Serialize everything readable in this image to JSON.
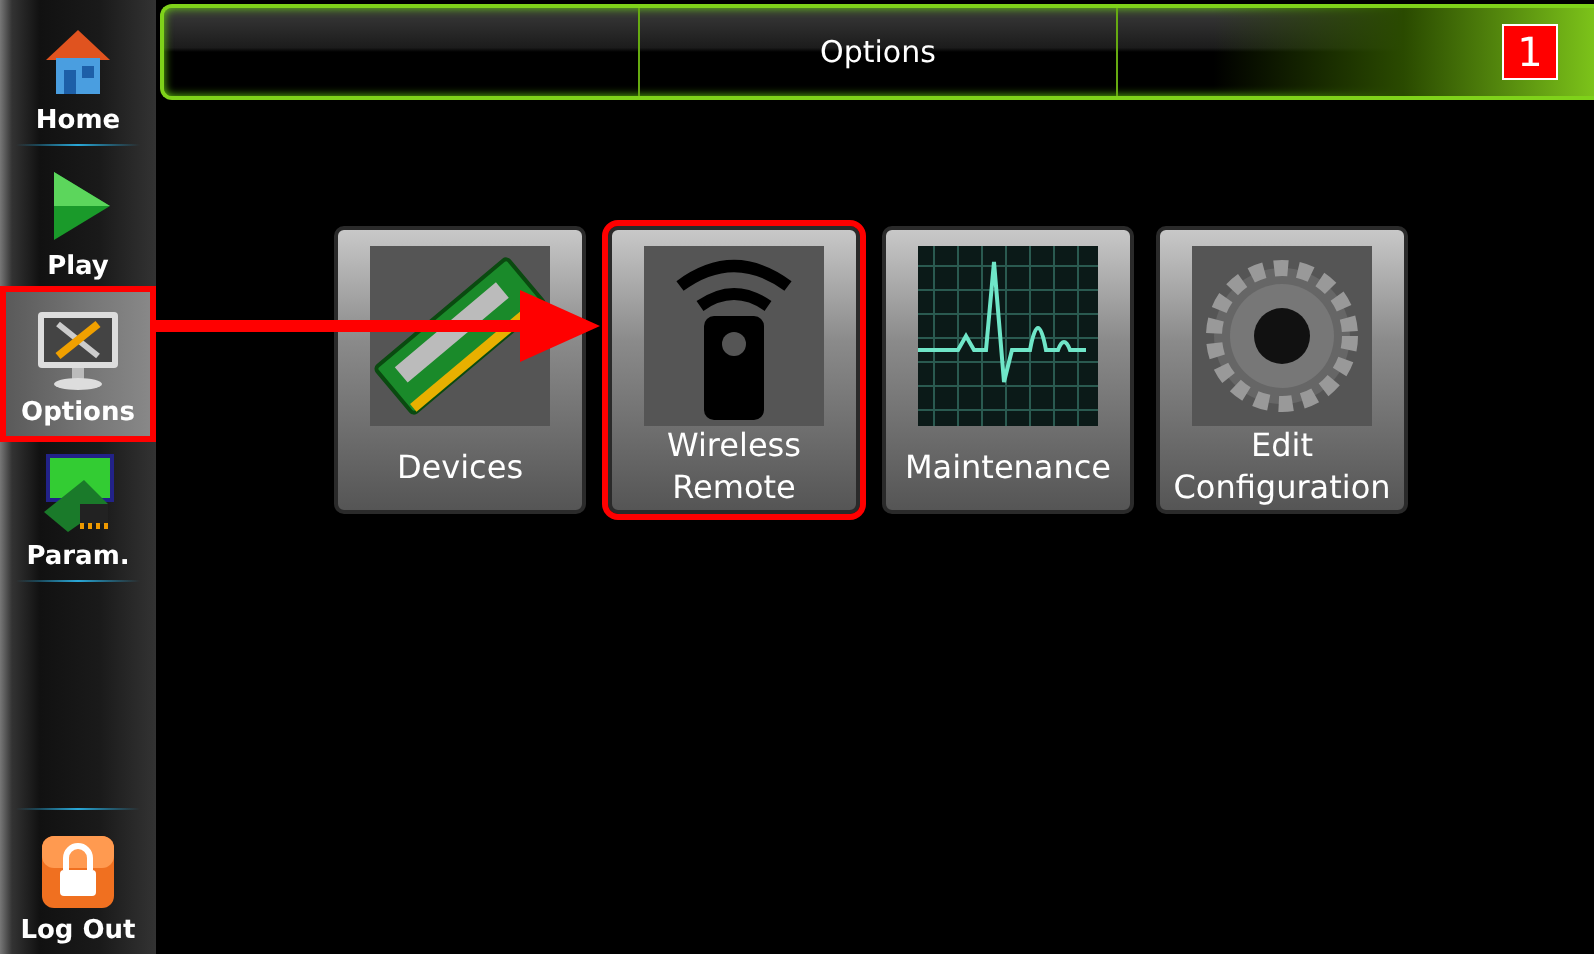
{
  "sidebar": {
    "items": [
      {
        "label": "Home",
        "kind": "home",
        "selected": false,
        "highlighted": false
      },
      {
        "label": "Play",
        "kind": "play",
        "selected": false,
        "highlighted": false
      },
      {
        "label": "Options",
        "kind": "options",
        "selected": true,
        "highlighted": true
      },
      {
        "label": "Param.",
        "kind": "params",
        "selected": false,
        "highlighted": false
      },
      {
        "label": "Log Out",
        "kind": "logout",
        "selected": false,
        "highlighted": false
      }
    ]
  },
  "header": {
    "title": "Options",
    "badge": "1"
  },
  "tiles": [
    {
      "label": "Devices",
      "kind": "devices",
      "highlighted": false
    },
    {
      "label": "Wireless Remote",
      "kind": "remote",
      "highlighted": true
    },
    {
      "label": "Maintenance",
      "kind": "maintenance",
      "highlighted": false
    },
    {
      "label": "Edit Configuration",
      "kind": "config",
      "highlighted": false
    }
  ]
}
